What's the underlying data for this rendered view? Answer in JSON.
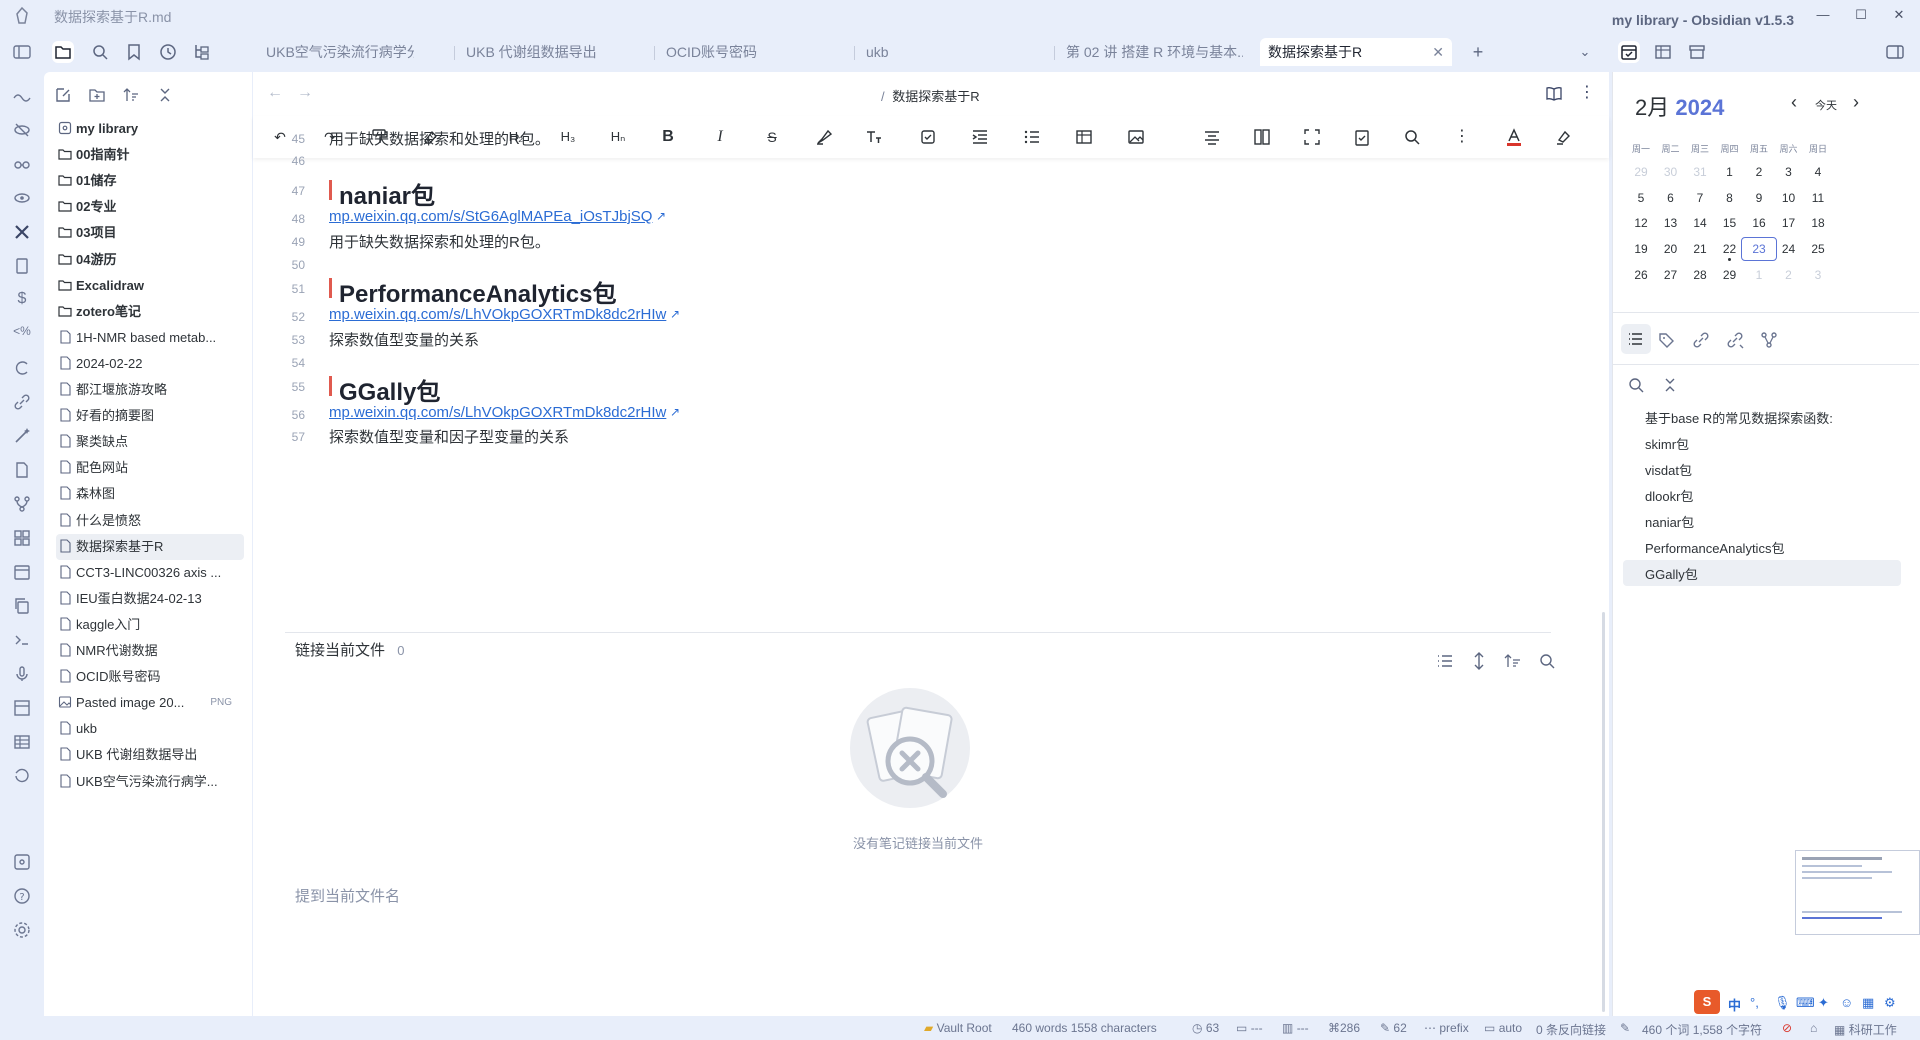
{
  "window": {
    "doc_title": "数据探索基于R.md",
    "app_title": "my library - Obsidian v1.5.3"
  },
  "tabs": [
    {
      "label": "UKB空气污染流行病学分析结..."
    },
    {
      "label": "UKB 代谢组数据导出"
    },
    {
      "label": "OCID账号密码"
    },
    {
      "label": "ukb"
    },
    {
      "label": "第 02 讲 搭建 R 环境与基本..."
    },
    {
      "label": "数据探索基于R",
      "active": true
    }
  ],
  "file_tree": [
    {
      "label": "my library",
      "type": "vault"
    },
    {
      "label": "00指南针",
      "type": "folder"
    },
    {
      "label": "01储存",
      "type": "folder"
    },
    {
      "label": "02专业",
      "type": "folder"
    },
    {
      "label": "03项目",
      "type": "folder"
    },
    {
      "label": "04游历",
      "type": "folder"
    },
    {
      "label": "Excalidraw",
      "type": "folder"
    },
    {
      "label": "zotero笔记",
      "type": "folder"
    },
    {
      "label": "1H-NMR based metab...",
      "type": "file"
    },
    {
      "label": "2024-02-22",
      "type": "file"
    },
    {
      "label": "都江堰旅游攻略",
      "type": "file"
    },
    {
      "label": "好看的摘要图",
      "type": "file"
    },
    {
      "label": "聚类缺点",
      "type": "file"
    },
    {
      "label": "配色网站",
      "type": "file"
    },
    {
      "label": "森林图",
      "type": "file"
    },
    {
      "label": "什么是愤怒",
      "type": "file"
    },
    {
      "label": "数据探索基于R",
      "type": "file",
      "active": true
    },
    {
      "label": "CCT3-LINC00326 axis ...",
      "type": "file"
    },
    {
      "label": "IEU蛋白数据24-02-13",
      "type": "file"
    },
    {
      "label": "kaggle入门",
      "type": "file"
    },
    {
      "label": "NMR代谢数据",
      "type": "file"
    },
    {
      "label": "OCID账号密码",
      "type": "file"
    },
    {
      "label": "Pasted image 20...",
      "type": "image",
      "badge": "PNG"
    },
    {
      "label": "ukb",
      "type": "file"
    },
    {
      "label": "UKB 代谢组数据导出",
      "type": "file"
    },
    {
      "label": "UKB空气污染流行病学...",
      "type": "file"
    }
  ],
  "editor": {
    "breadcrumb_sep": "/",
    "breadcrumb": "数据探索基于R",
    "toolbar": {
      "h2": "H₂",
      "h3": "H₃",
      "hn": "Hₙ",
      "bold": "B",
      "italic": "I",
      "strike": "S"
    },
    "lines": [
      {
        "num": "45",
        "kind": "text",
        "text": "用于缺失数据探索和处理的R包。"
      },
      {
        "num": "46",
        "kind": "blank",
        "text": ""
      },
      {
        "num": "47",
        "kind": "heading",
        "text": "naniar包"
      },
      {
        "num": "48",
        "kind": "link",
        "text": "mp.weixin.qq.com/s/StG6AglMAPEa_iOsTJbjSQ"
      },
      {
        "num": "49",
        "kind": "text",
        "text": "用于缺失数据探索和处理的R包。"
      },
      {
        "num": "50",
        "kind": "blank",
        "text": ""
      },
      {
        "num": "51",
        "kind": "heading",
        "text": "PerformanceAnalytics包"
      },
      {
        "num": "52",
        "kind": "link",
        "text": "mp.weixin.qq.com/s/LhVOkpGOXRTmDk8dc2rHIw"
      },
      {
        "num": "53",
        "kind": "text",
        "text": "探索数值型变量的关系"
      },
      {
        "num": "54",
        "kind": "blank",
        "text": ""
      },
      {
        "num": "55",
        "kind": "heading",
        "text": "GGally包"
      },
      {
        "num": "56",
        "kind": "link",
        "text": "mp.weixin.qq.com/s/LhVOkpGOXRTmDk8dc2rHIw"
      },
      {
        "num": "57",
        "kind": "text",
        "text": "探索数值型变量和因子型变量的关系"
      }
    ]
  },
  "backlinks": {
    "title": "链接当前文件",
    "count": "0",
    "empty_text": "没有笔记链接当前文件",
    "unlinked_title": "提到当前文件名"
  },
  "calendar": {
    "month": "2月",
    "year": "2024",
    "today_label": "今天",
    "weekdays": [
      "周一",
      "周二",
      "周三",
      "周四",
      "周五",
      "周六",
      "周日"
    ],
    "weeks": [
      [
        {
          "d": "29",
          "m": true
        },
        {
          "d": "30",
          "m": true
        },
        {
          "d": "31",
          "m": true
        },
        {
          "d": "1"
        },
        {
          "d": "2"
        },
        {
          "d": "3"
        },
        {
          "d": "4"
        }
      ],
      [
        {
          "d": "5"
        },
        {
          "d": "6"
        },
        {
          "d": "7"
        },
        {
          "d": "8"
        },
        {
          "d": "9"
        },
        {
          "d": "10"
        },
        {
          "d": "11"
        }
      ],
      [
        {
          "d": "12"
        },
        {
          "d": "13"
        },
        {
          "d": "14"
        },
        {
          "d": "15"
        },
        {
          "d": "16"
        },
        {
          "d": "17"
        },
        {
          "d": "18"
        }
      ],
      [
        {
          "d": "19"
        },
        {
          "d": "20"
        },
        {
          "d": "21"
        },
        {
          "d": "22",
          "dot": true
        },
        {
          "d": "23",
          "today": true
        },
        {
          "d": "24"
        },
        {
          "d": "25"
        }
      ],
      [
        {
          "d": "26"
        },
        {
          "d": "27"
        },
        {
          "d": "28"
        },
        {
          "d": "29"
        },
        {
          "d": "1",
          "m": true
        },
        {
          "d": "2",
          "m": true
        },
        {
          "d": "3",
          "m": true
        }
      ]
    ],
    "accent": "#5b74d6"
  },
  "outline": [
    {
      "label": "基于base R的常见数据探索函数:"
    },
    {
      "label": "skimr包"
    },
    {
      "label": "visdat包"
    },
    {
      "label": "dlookr包"
    },
    {
      "label": "naniar包"
    },
    {
      "label": "PerformanceAnalytics包"
    },
    {
      "label": "GGally包",
      "active": true
    }
  ],
  "status": {
    "vault_root": "Vault Root",
    "words": "460 words 1558 characters",
    "s1": "63",
    "s2": "---",
    "s3": "---",
    "s4": "286",
    "s5": "62",
    "prefix": "prefix",
    "auto": "auto",
    "backlinks": "0 条反向链接",
    "count_cn": "460 个词  1,558 个字符",
    "research": "科研工作"
  },
  "ime": {
    "lang": "中",
    "punct": "°,"
  },
  "colors": {
    "link": "#2b6cd4",
    "heading_bar": "#e05a4f",
    "accent": "#5b74d6"
  }
}
